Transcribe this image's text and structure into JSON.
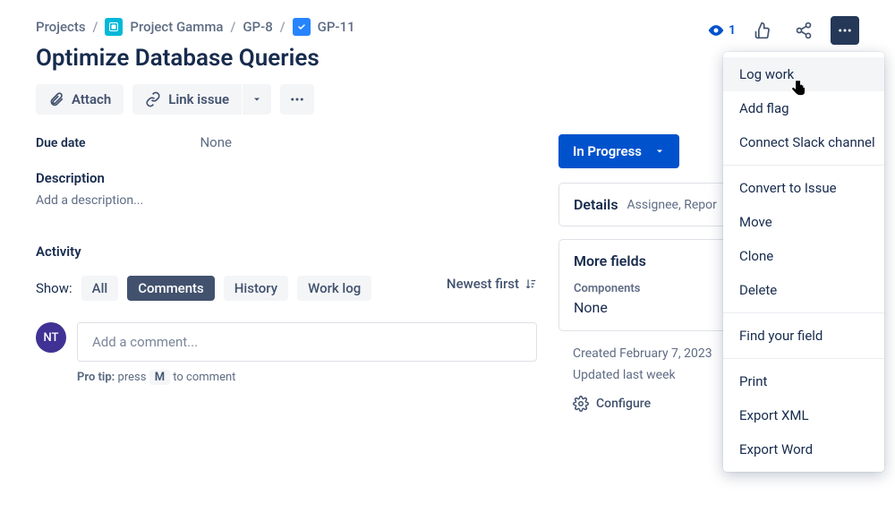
{
  "breadcrumb": {
    "root": "Projects",
    "project": "Project Gamma",
    "parent_key": "GP-8",
    "issue_key": "GP-11"
  },
  "top": {
    "watch_count": "1"
  },
  "issue": {
    "title": "Optimize Database Queries",
    "attach_label": "Attach",
    "link_label": "Link issue",
    "due_label": "Due date",
    "due_value": "None",
    "description_label": "Description",
    "description_placeholder": "Add a description...",
    "activity_label": "Activity"
  },
  "activity": {
    "show_label": "Show:",
    "tabs": {
      "all": "All",
      "comments": "Comments",
      "history": "History",
      "worklog": "Work log"
    },
    "sort_label": "Newest first",
    "comment_placeholder": "Add a comment...",
    "avatar_initials": "NT",
    "protip_prefix": "Pro tip:",
    "protip_text_before": " press ",
    "protip_key": "M",
    "protip_text_after": " to comment"
  },
  "right_panel": {
    "status": "In Progress",
    "details_label": "Details",
    "details_hint": "Assignee, Repor",
    "more_fields_label": "More fields",
    "components_label": "Components",
    "components_value": "None",
    "created_text": "Created February 7, 2023",
    "updated_text": "Updated last week",
    "configure_label": "Configure"
  },
  "menu": {
    "log_work": "Log work",
    "add_flag": "Add flag",
    "connect_slack": "Connect Slack channel",
    "convert": "Convert to Issue",
    "move": "Move",
    "clone": "Clone",
    "delete": "Delete",
    "find_field": "Find your field",
    "print": "Print",
    "export_xml": "Export XML",
    "export_word": "Export Word"
  }
}
